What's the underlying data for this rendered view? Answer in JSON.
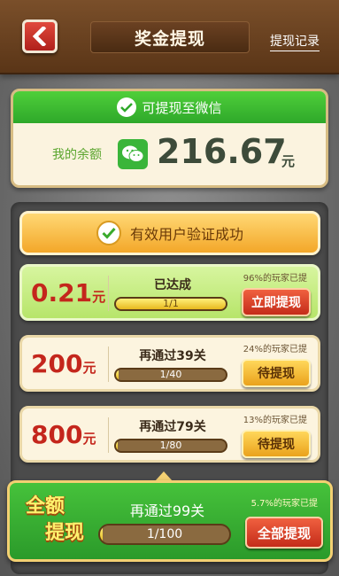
{
  "header": {
    "title": "奖金提现",
    "record_link": "提现记录"
  },
  "balance": {
    "header_text": "可提现至微信",
    "label": "我的余额",
    "amount": "216.67",
    "unit": "元"
  },
  "verify": {
    "text": "有效用户验证成功"
  },
  "tiers": [
    {
      "amount": "0.21",
      "unit": "元",
      "status": "已达成",
      "progress_text": "1/1",
      "progress_fraction": 1.0,
      "percent_text": "96%的玩家已提",
      "button": "立即提现",
      "button_style": "red"
    },
    {
      "amount": "200",
      "unit": "元",
      "status": "再通过39关",
      "progress_text": "1/40",
      "progress_fraction": 0.025,
      "percent_text": "24%的玩家已提",
      "button": "待提现",
      "button_style": "yellow"
    },
    {
      "amount": "800",
      "unit": "元",
      "status": "再通过79关",
      "progress_text": "1/80",
      "progress_fraction": 0.0125,
      "percent_text": "13%的玩家已提",
      "button": "待提现",
      "button_style": "yellow"
    }
  ],
  "full": {
    "label_line1": "全额",
    "label_line2": "提现",
    "status": "再通过99关",
    "progress_text": "1/100",
    "progress_fraction": 0.01,
    "percent_text": "5.7%的玩家已提",
    "button": "全部提现"
  },
  "colors": {
    "header_brown": "#6b4122",
    "wechat_green": "#3ab53a",
    "amount_red": "#c4261c",
    "banner_orange": "#f3a729"
  },
  "icons": [
    "back-arrow-icon",
    "wechat-check-icon",
    "wechat-logo-icon",
    "checkmark-icon"
  ]
}
